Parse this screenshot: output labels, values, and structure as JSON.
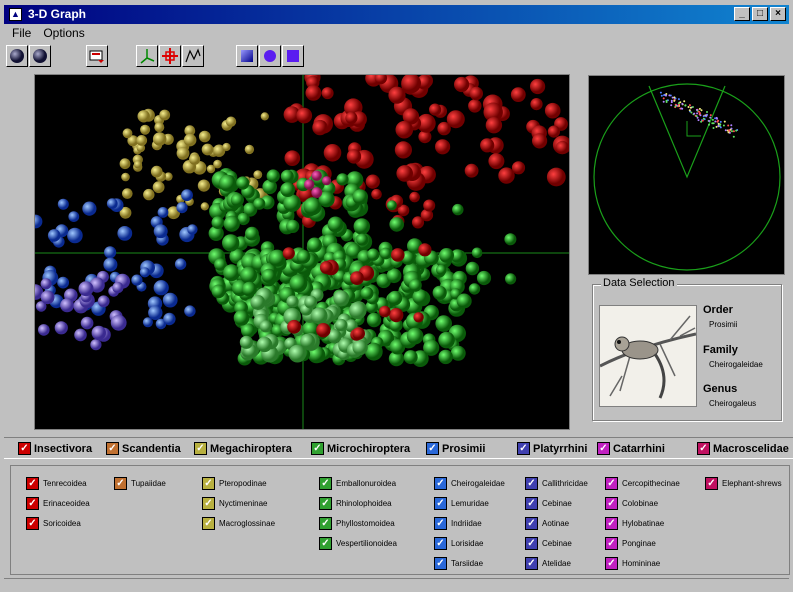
{
  "window": {
    "title": "3-D Graph",
    "buttons": [
      "_",
      "□",
      "×"
    ]
  },
  "menu": [
    "File",
    "Options"
  ],
  "toolbar": {
    "groups": [
      {
        "icons": [
          "sphere-shaded-icon",
          "sphere-shaded-alt-icon"
        ]
      },
      {
        "icons": [
          "export-icon"
        ]
      },
      {
        "icons": [
          "axes-icon",
          "crosshair-icon",
          "scatter-trace-icon"
        ]
      },
      {
        "icons": [
          "cube-shape-icon",
          "sphere-shape-icon",
          "square-shape-icon"
        ]
      }
    ]
  },
  "data_selection": {
    "legend": "Data Selection",
    "order_label": "Order",
    "order_value": "Prosimii",
    "family_label": "Family",
    "family_value": "Cheirogaleidae",
    "genus_label": "Genus",
    "genus_value": "Cheirogaleus"
  },
  "orders": [
    {
      "name": "Insectivora",
      "color": "#cc0000",
      "families": [
        "Tenrecoidea",
        "Erinaceoidea",
        "Soricoidea"
      ]
    },
    {
      "name": "Scandentia",
      "color": "#c07030",
      "families": [
        "Tupaiidae"
      ]
    },
    {
      "name": "Megachiroptera",
      "color": "#b8b040",
      "families": [
        "Pteropodinae",
        "Nyctimeninae",
        "Macroglossinae"
      ]
    },
    {
      "name": "Microchiroptera",
      "color": "#30a030",
      "families": [
        "Emballonuroidea",
        "Rhinolophoidea",
        "Phyllostomoidea",
        "Vespertilionoidea"
      ]
    },
    {
      "name": "Prosimii",
      "color": "#2a68d8",
      "families": [
        "Cheirogaleidae",
        "Lemuridae",
        "Indriidae",
        "Lorisidae",
        "Tarsiidae"
      ]
    },
    {
      "name": "Platyrrhini",
      "color": "#4040b0",
      "families": [
        "Callithricidae",
        "Cebinae",
        "Aotinae",
        "Cebinae",
        "Atelidae"
      ]
    },
    {
      "name": "Catarrhini",
      "color": "#c020c0",
      "families": [
        "Cercopithecinae",
        "Colobinae",
        "Hylobatinae",
        "Ponginae",
        "Homininae"
      ]
    },
    {
      "name": "Macroscelidae",
      "color": "#c01060",
      "families": [
        "Elephant-shrews"
      ]
    }
  ]
}
